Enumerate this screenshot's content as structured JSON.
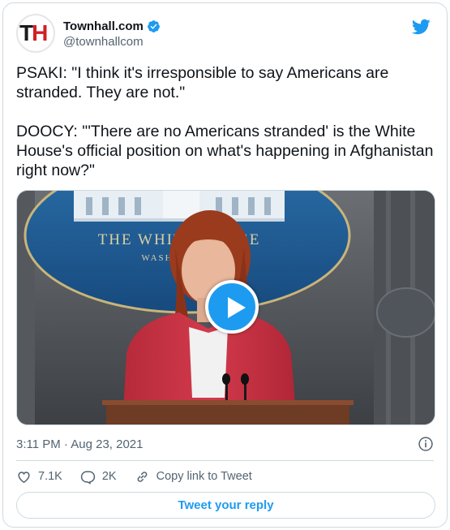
{
  "author": {
    "avatar_letters": [
      "T",
      "H"
    ],
    "name": "Townhall.com",
    "handle": "@townhallcom",
    "verified": true
  },
  "tweet": {
    "paragraphs": [
      "PSAKI: \"I think it's irresponsible to say Americans are stranded. They are not.\"",
      "DOOCY: \"'There are no Americans stranded' is the White House's official position on what's happening in Afghanistan right now?\""
    ],
    "timestamp": "3:11 PM · Aug 23, 2021"
  },
  "media": {
    "type": "video",
    "seal_text_1": "THE WHITE HOUSE",
    "seal_text_2": "WASHINGTON"
  },
  "actions": {
    "likes": "7.1K",
    "replies": "2K",
    "copy_link": "Copy link to Tweet"
  },
  "reply_button": "Tweet your reply",
  "colors": {
    "accent": "#1d9bf0",
    "text": "#0f1419",
    "muted": "#536471",
    "border": "#cfd9de",
    "logo_red": "#d11f26"
  }
}
